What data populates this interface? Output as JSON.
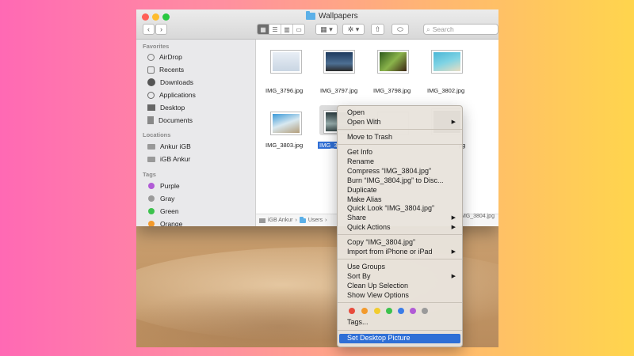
{
  "finder": {
    "title": "Wallpapers",
    "search_placeholder": "Search",
    "sidebar": {
      "favorites_label": "Favorites",
      "favorites": [
        {
          "label": "AirDrop",
          "icon": "airdrop-icon"
        },
        {
          "label": "Recents",
          "icon": "recents-icon"
        },
        {
          "label": "Downloads",
          "icon": "downloads-icon"
        },
        {
          "label": "Applications",
          "icon": "applications-icon"
        },
        {
          "label": "Desktop",
          "icon": "desktop-icon"
        },
        {
          "label": "Documents",
          "icon": "documents-icon"
        }
      ],
      "locations_label": "Locations",
      "locations": [
        {
          "label": "Ankur iGB",
          "icon": "disk-icon"
        },
        {
          "label": "iGB Ankur",
          "icon": "disk-icon"
        }
      ],
      "tags_label": "Tags",
      "tags": [
        {
          "label": "Purple",
          "color": "#b15bd6"
        },
        {
          "label": "Gray",
          "color": "#9a9a9a"
        },
        {
          "label": "Green",
          "color": "#3cc24d"
        },
        {
          "label": "Orange",
          "color": "#f39a2b"
        }
      ]
    },
    "files": [
      {
        "name": "IMG_3796.jpg"
      },
      {
        "name": "IMG_3797.jpg"
      },
      {
        "name": "IMG_3798.jpg"
      },
      {
        "name": "IMG_3802.jpg"
      },
      {
        "name": "IMG_3803.jpg"
      },
      {
        "name": "IMG_3",
        "selected": true
      },
      {
        "name": ""
      },
      {
        "name": "pg"
      }
    ],
    "pathbar": {
      "items": [
        "iGB Ankur",
        "Users"
      ],
      "end": "IMG_3804.jpg"
    }
  },
  "context_menu": {
    "items": [
      {
        "label": "Open"
      },
      {
        "label": "Open With",
        "submenu": true
      },
      {
        "label": "Move to Trash"
      },
      {
        "label": "Get Info"
      },
      {
        "label": "Rename"
      },
      {
        "label": "Compress “IMG_3804.jpg”"
      },
      {
        "label": "Burn “IMG_3804.jpg” to Disc..."
      },
      {
        "label": "Duplicate"
      },
      {
        "label": "Make Alias"
      },
      {
        "label": "Quick Look “IMG_3804.jpg”"
      },
      {
        "label": "Share",
        "submenu": true
      },
      {
        "label": "Quick Actions",
        "submenu": true
      },
      {
        "label": "Copy “IMG_3804.jpg”"
      },
      {
        "label": "Import from iPhone or iPad",
        "submenu": true
      },
      {
        "label": "Use Groups"
      },
      {
        "label": "Sort By",
        "submenu": true
      },
      {
        "label": "Clean Up Selection"
      },
      {
        "label": "Show View Options"
      },
      {
        "label": "Tags..."
      },
      {
        "label": "Set Desktop Picture",
        "highlighted": true
      }
    ],
    "tag_colors": [
      "#e84b3c",
      "#f39a2b",
      "#f2cc2e",
      "#3cc24d",
      "#3b7de8",
      "#b15bd6",
      "#9a9a9a"
    ]
  },
  "colors": {
    "menu_highlight": "#2f6fd6",
    "selection": "#2f6fd6"
  }
}
